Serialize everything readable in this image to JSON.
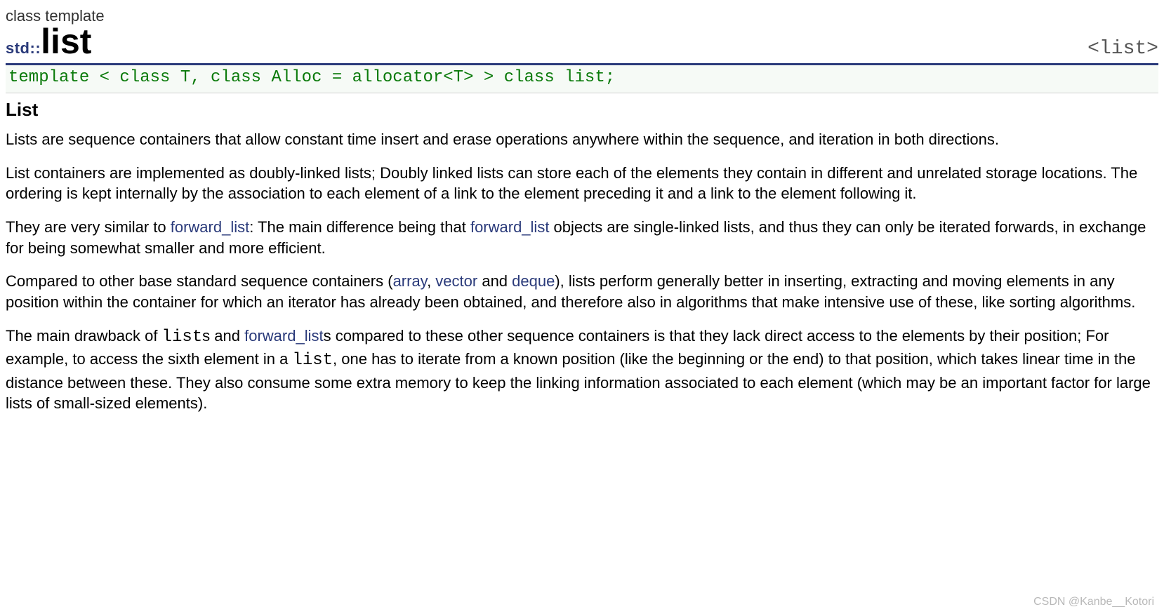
{
  "header": {
    "kind": "class template",
    "namespace": "std::",
    "name": "list",
    "include": "<list>"
  },
  "declaration": "template < class T, class Alloc = allocator<T> > class list;",
  "section_title": "List",
  "paragraphs": {
    "p1": "Lists are sequence containers that allow constant time insert and erase operations anywhere within the sequence, and iteration in both directions.",
    "p2": "List containers are implemented as doubly-linked lists; Doubly linked lists can store each of the elements they contain in different and unrelated storage locations. The ordering is kept internally by the association to each element of a link to the element preceding it and a link to the element following it.",
    "p3_a": "They are very similar to ",
    "p3_link1": "forward_list",
    "p3_b": ": The main difference being that ",
    "p3_link2": "forward_list",
    "p3_c": " objects are single-linked lists, and thus they can only be iterated forwards, in exchange for being somewhat smaller and more efficient.",
    "p4_a": "Compared to other base standard sequence containers (",
    "p4_link1": "array",
    "p4_b": ", ",
    "p4_link2": "vector",
    "p4_c": " and ",
    "p4_link3": "deque",
    "p4_d": "), lists perform generally better in inserting, extracting and moving elements in any position within the container for which an iterator has already been obtained, and therefore also in algorithms that make intensive use of these, like sorting algorithms.",
    "p5_a": "The main drawback of ",
    "p5_mono1": "list",
    "p5_b": "s and ",
    "p5_link1": "forward_list",
    "p5_c": "s compared to these other sequence containers is that they lack direct access to the elements by their position; For example, to access the sixth element in a ",
    "p5_mono2": "list",
    "p5_d": ", one has to iterate from a known position (like the beginning or the end) to that position, which takes linear time in the distance between these. They also consume some extra memory to keep the linking information associated to each element (which may be an important factor for large lists of small-sized elements)."
  },
  "watermark": "CSDN @Kanbe__Kotori"
}
